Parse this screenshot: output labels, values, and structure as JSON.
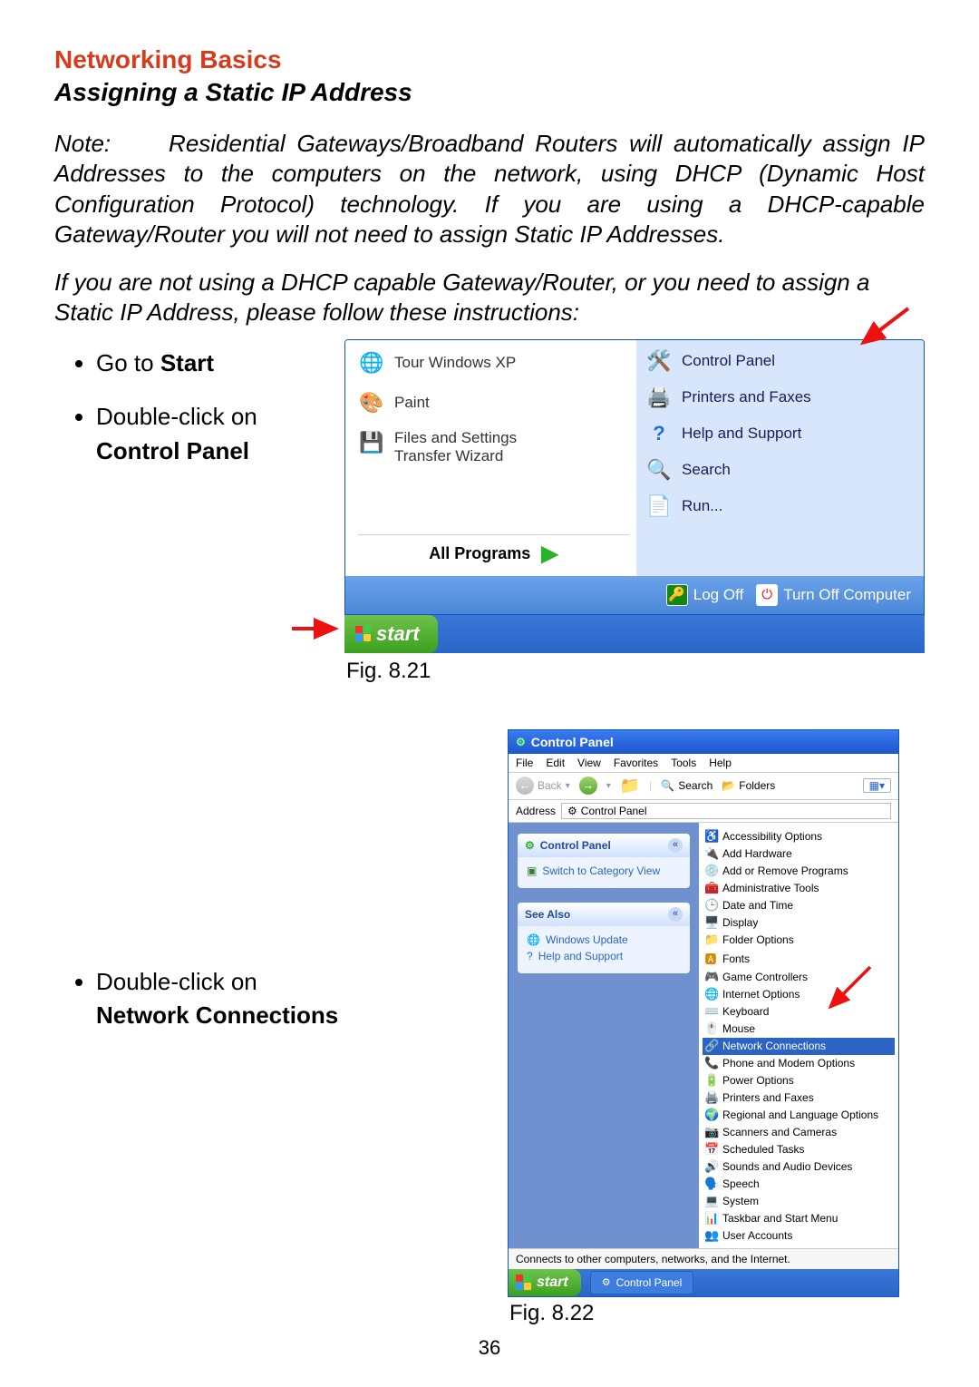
{
  "headings": {
    "h1": "Networking Basics",
    "h2": "Assigning a Static IP Address"
  },
  "paragraphs": {
    "note_label": "Note:",
    "note_body": "Residential Gateways/Broadband Routers will automatically assign IP Addresses to the computers on the network, using DHCP (Dynamic Host Configuration Protocol) technology.  If you are using a DHCP-capable Gateway/Router you will not need to assign Static IP Addresses.",
    "p2": "If you are not using a DHCP capable Gateway/Router, or you need to assign a Static IP Address, please follow these instructions:"
  },
  "bullets1": {
    "b1_pre": "Go to ",
    "b1_bold": "Start",
    "b2_pre": "Double-click on",
    "b2_bold": "Control Panel"
  },
  "bullets2": {
    "b1_pre": "Double-click on",
    "b1_bold": "Network Connections"
  },
  "startmenu": {
    "left": {
      "tour": "Tour Windows XP",
      "paint": "Paint",
      "fstw": "Files and Settings Transfer Wizard",
      "allprog": "All Programs"
    },
    "right": {
      "cp": "Control Panel",
      "pf": "Printers and Faxes",
      "help": "Help and Support",
      "search": "Search",
      "run": "Run..."
    },
    "footer": {
      "logoff": "Log Off",
      "turnoff": "Turn Off Computer"
    },
    "start": "start"
  },
  "figcaps": {
    "f1": "Fig. 8.21",
    "f2": "Fig. 8.22"
  },
  "cp": {
    "title": "Control Panel",
    "menus": {
      "file": "File",
      "edit": "Edit",
      "view": "View",
      "fav": "Favorites",
      "tools": "Tools",
      "help": "Help"
    },
    "toolbar": {
      "back": "Back",
      "search": "Search",
      "folders": "Folders"
    },
    "address_label": "Address",
    "address_value": "Control Panel",
    "side": {
      "pane1_title": "Control Panel",
      "pane1_link": "Switch to Category View",
      "pane2_title": "See Also",
      "pane2_link1": "Windows Update",
      "pane2_link2": "Help and Support"
    },
    "items": {
      "i0": "Accessibility Options",
      "i1": "Add Hardware",
      "i2": "Add or Remove Programs",
      "i3": "Administrative Tools",
      "i4": "Date and Time",
      "i5": "Display",
      "i6": "Folder Options",
      "i7": "Fonts",
      "i8": "Game Controllers",
      "i9": "Internet Options",
      "i10": "Keyboard",
      "i11": "Mouse",
      "i12": "Network Connections",
      "i13": "Phone and Modem Options",
      "i14": "Power Options",
      "i15": "Printers and Faxes",
      "i16": "Regional and Language Options",
      "i17": "Scanners and Cameras",
      "i18": "Scheduled Tasks",
      "i19": "Sounds and Audio Devices",
      "i20": "Speech",
      "i21": "System",
      "i22": "Taskbar and Start Menu",
      "i23": "User Accounts"
    },
    "status": "Connects to other computers, networks, and the Internet.",
    "taskbar": {
      "start": "start",
      "btn": "Control Panel"
    }
  },
  "pagenum": "36"
}
